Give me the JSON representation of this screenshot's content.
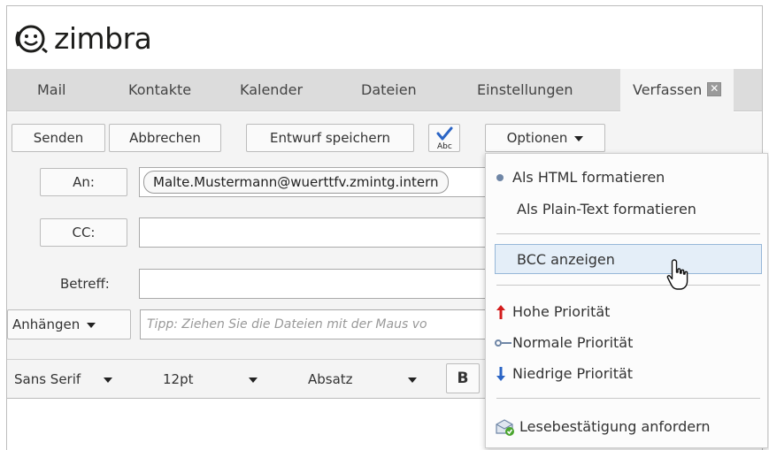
{
  "brand": {
    "name": "zimbra"
  },
  "tabs": [
    {
      "label": "Mail"
    },
    {
      "label": "Kontakte"
    },
    {
      "label": "Kalender"
    },
    {
      "label": "Dateien"
    },
    {
      "label": "Einstellungen"
    },
    {
      "label": "Verfassen",
      "active": true
    }
  ],
  "toolbar": {
    "send": "Senden",
    "cancel": "Abbrechen",
    "save_draft": "Entwurf speichern",
    "spell_icon_text": "Abc",
    "options": "Optionen"
  },
  "compose": {
    "to_label": "An:",
    "to_value": "Malte.Mustermann@wuerttfv.zmintg.intern",
    "cc_label": "CC:",
    "subject_label": "Betreff:",
    "attach": "Anhängen",
    "attach_hint": "Tipp: Ziehen Sie die Dateien mit der Maus vo"
  },
  "format_toolbar": {
    "font": "Sans Serif",
    "size": "12pt",
    "block": "Absatz",
    "bold": "B"
  },
  "options_menu": {
    "html": "Als HTML formatieren",
    "plain": "Als Plain-Text formatieren",
    "bcc": "BCC anzeigen",
    "high": "Hohe Priorität",
    "normal": "Normale Priorität",
    "low": "Niedrige Priorität",
    "read_receipt": "Lesebestätigung anfordern"
  },
  "colors": {
    "tab_bar": "#dcdcdc",
    "panel": "#f4f4f4",
    "highlight": "#e4eef8",
    "priority_high": "#d31c1c",
    "priority_low": "#2a64c5"
  }
}
